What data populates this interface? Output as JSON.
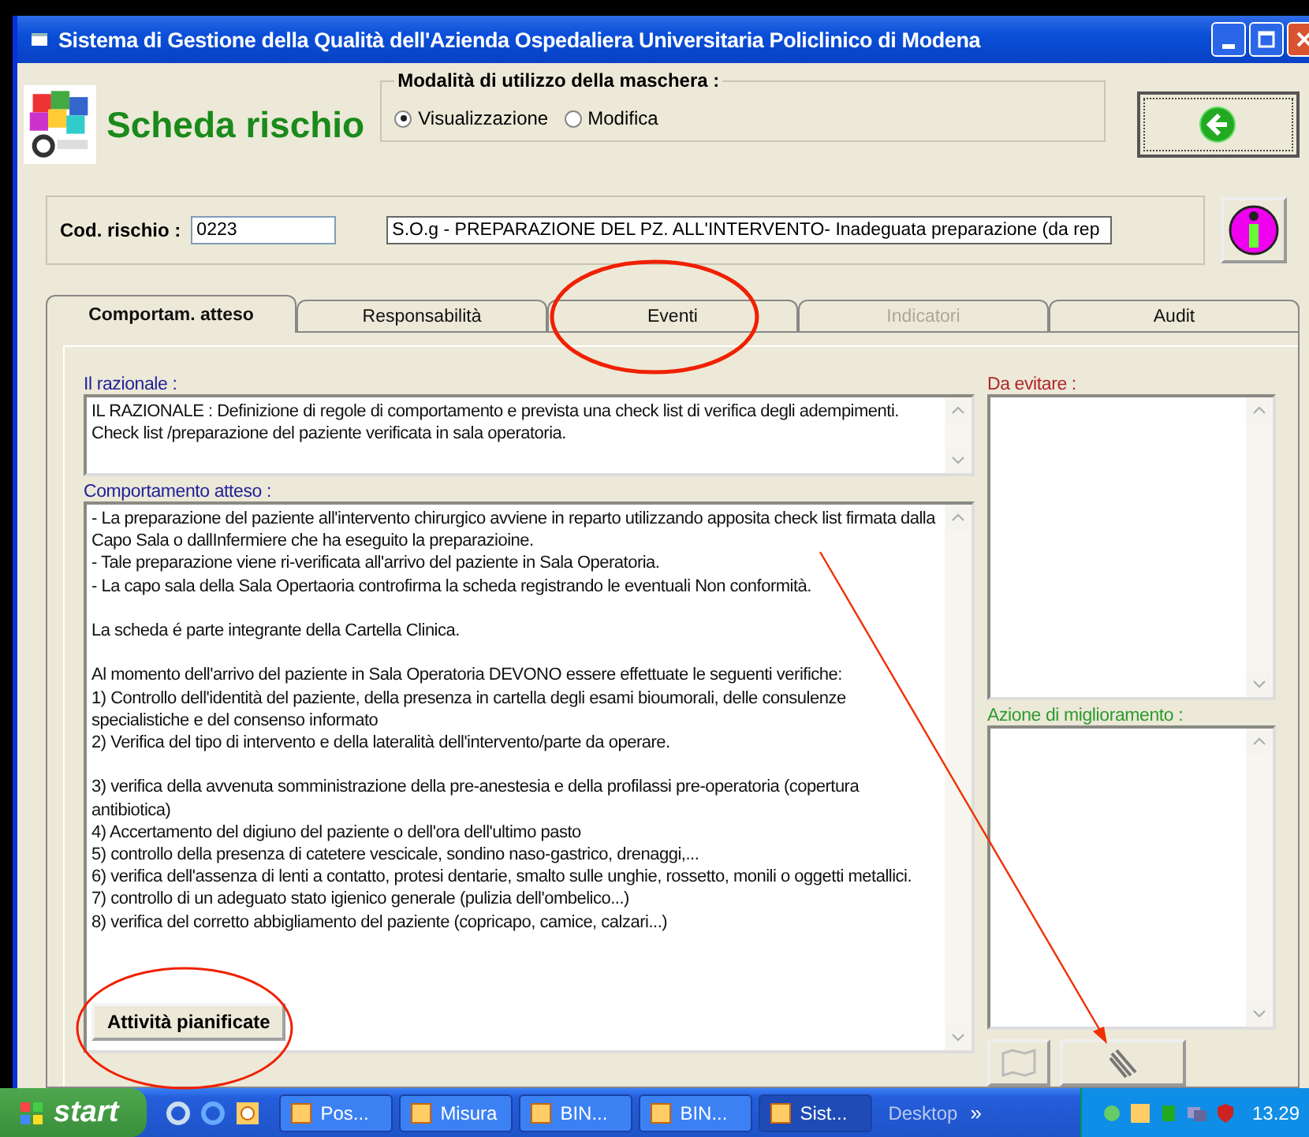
{
  "window": {
    "title": "Sistema di Gestione della Qualità dell'Azienda Ospedaliera Universitaria Policlinico di Modena"
  },
  "header": {
    "title": "Scheda rischio",
    "mode_label": "Modalità di utilizzo della maschera :",
    "modes": [
      {
        "label": "Visualizzazione",
        "selected": true
      },
      {
        "label": "Modifica",
        "selected": false
      }
    ]
  },
  "risk": {
    "code_label": "Cod. rischio :",
    "code": "0223",
    "description": "S.O.g - PREPARAZIONE DEL PZ. ALL'INTERVENTO- Inadeguata preparazione (da rep"
  },
  "tabs": [
    {
      "label": "Comportam. atteso",
      "selected": true,
      "disabled": false
    },
    {
      "label": "Responsabilità",
      "selected": false,
      "disabled": false
    },
    {
      "label": "Eventi",
      "selected": false,
      "disabled": false
    },
    {
      "label": "Indicatori",
      "selected": false,
      "disabled": true
    },
    {
      "label": "Audit",
      "selected": false,
      "disabled": false
    }
  ],
  "rationale": {
    "label": "Il razionale :",
    "lines": [
      "IL RAZIONALE : Definizione di regole di comportamento e prevista una check list di verifica degli adempimenti.",
      "Check list /preparazione del paziente verificata in sala operatoria."
    ]
  },
  "expected": {
    "label": "Comportamento atteso :",
    "blocks": [
      [
        "- La preparazione del paziente all'intervento chirurgico avviene in reparto utilizzando apposita check list firmata dalla Capo Sala o dallInfermiere che ha eseguito la preparazioine.",
        "- Tale preparazione viene ri-verificata all'arrivo del paziente in Sala Operatoria.",
        "- La capo sala della Sala Opertaoria controfirma la scheda registrando le eventuali Non conformità."
      ],
      [
        "La scheda é parte integrante della Cartella Clinica."
      ],
      [
        "Al momento dell'arrivo del paziente in Sala Operatoria DEVONO essere effettuate le seguenti verifiche:",
        "1) Controllo dell'identità del paziente, della presenza in cartella degli esami bioumorali, delle consulenze specialistiche e del consenso informato",
        "2) Verifica del tipo di intervento e della lateralità dell'intervento/parte da operare."
      ],
      [
        "3) verifica della avvenuta somministrazione della pre-anestesia e della profilassi pre-operatoria (copertura antibiotica)",
        "4) Accertamento del digiuno del paziente o dell'ora dell'ultimo pasto",
        "5) controllo della presenza di catetere vescicale, sondino naso-gastrico, drenaggi,...",
        "6) verifica dell'assenza di lenti a contatto, protesi dentarie, smalto sulle unghie, rossetto, monili o oggetti metallici.",
        "7) controllo di un adeguato stato igienico generale (pulizia dell'ombelico...)",
        "8) verifica del corretto abbigliamento del paziente (copricapo, camice, calzari...)"
      ]
    ],
    "button": "Attività pianificate"
  },
  "avoid": {
    "label": "Da evitare :"
  },
  "improvement": {
    "label": "Azione di miglioramento :"
  },
  "taskbar": {
    "start": "start",
    "tasks": [
      {
        "label": "Pos...",
        "selected": false
      },
      {
        "label": "Misura",
        "selected": false
      },
      {
        "label": "BIN...",
        "selected": false
      },
      {
        "label": "BIN...",
        "selected": false
      },
      {
        "label": "Sist...",
        "selected": true
      }
    ],
    "desktop": "Desktop",
    "chevron": "»",
    "clock": "13.29"
  }
}
